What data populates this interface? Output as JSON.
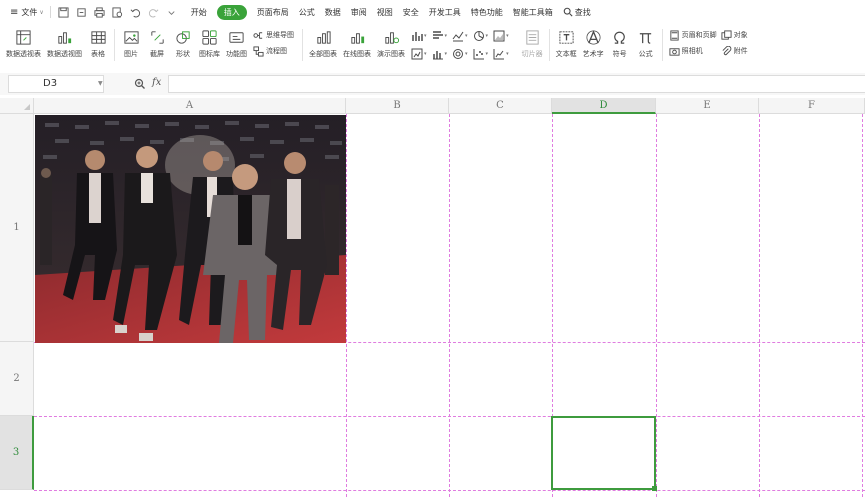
{
  "menubar": {
    "file_label": "文件",
    "tabs": [
      {
        "id": "home",
        "label": "开始",
        "active": false
      },
      {
        "id": "insert",
        "label": "插入",
        "active": true
      },
      {
        "id": "page-layout",
        "label": "页面布局",
        "active": false
      },
      {
        "id": "formulas",
        "label": "公式",
        "active": false
      },
      {
        "id": "data",
        "label": "数据",
        "active": false
      },
      {
        "id": "review",
        "label": "审阅",
        "active": false
      },
      {
        "id": "view",
        "label": "视图",
        "active": false
      },
      {
        "id": "security",
        "label": "安全",
        "active": false
      },
      {
        "id": "developer",
        "label": "开发工具",
        "active": false
      },
      {
        "id": "features",
        "label": "特色功能",
        "active": false
      },
      {
        "id": "smart-toolbox",
        "label": "智能工具箱",
        "active": false
      }
    ],
    "search_label": "查找"
  },
  "ribbon": {
    "pivot_table": "数据透视表",
    "pivot_chart": "数据透视图",
    "table": "表格",
    "picture": "图片",
    "screenshot": "截屏",
    "shape": "形状",
    "icon_library": "图标库",
    "function_chart": "功能图",
    "mind_map": "思维导图",
    "flowchart": "流程图",
    "all_charts": "全部图表",
    "online_charts": "在线图表",
    "demo_charts": "演示图表",
    "slicer": "切片器",
    "text_box": "文本框",
    "word_art": "艺术字",
    "symbol": "符号",
    "equation": "公式",
    "header_footer": "页眉和页脚",
    "camera": "照相机",
    "object": "对象",
    "attachment": "附件"
  },
  "formula_bar": {
    "cell_ref": "D3",
    "fx_label": "fx",
    "value": ""
  },
  "grid": {
    "columns": [
      "A",
      "B",
      "C",
      "D",
      "E",
      "F"
    ],
    "rows": [
      "1",
      "2",
      "3"
    ],
    "selected_cell": "D3",
    "selected_column": "D",
    "selected_row": "3"
  },
  "colors": {
    "accent": "#3aa33a",
    "selection": "#3e9b3e",
    "page_break": "#e07ce0",
    "header_bg": "#f5f5f5"
  }
}
